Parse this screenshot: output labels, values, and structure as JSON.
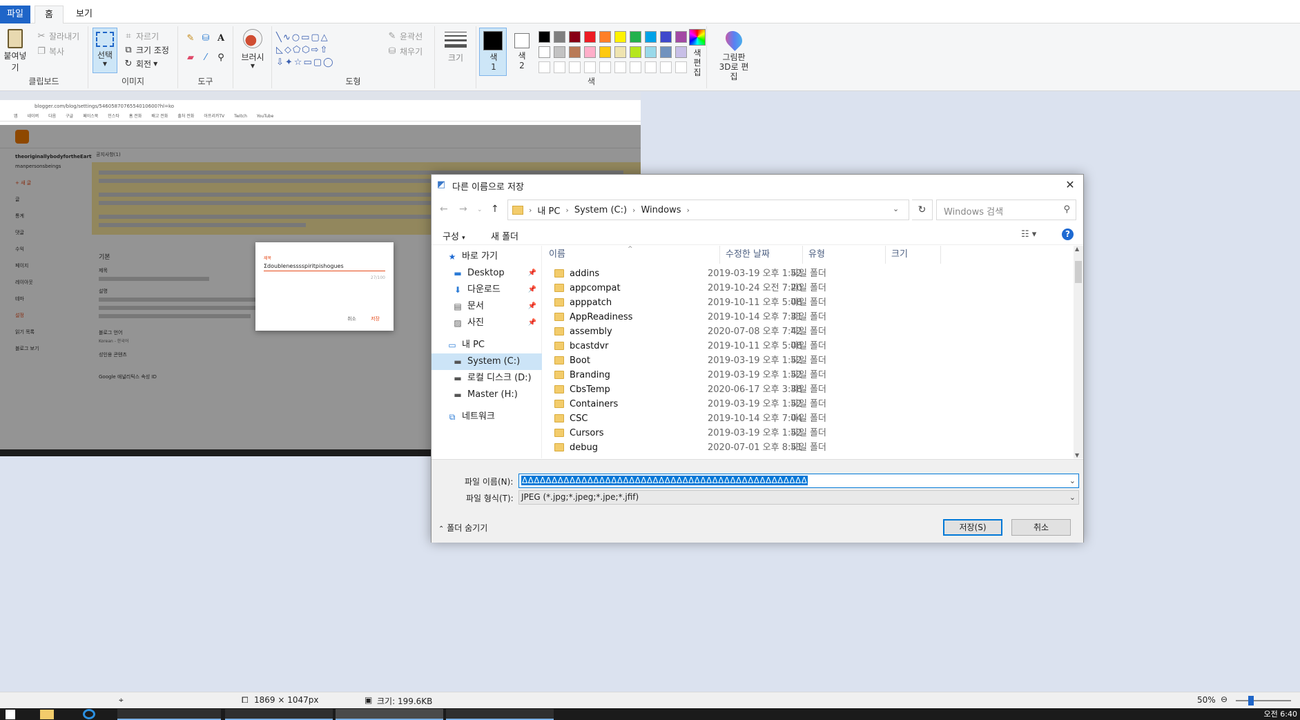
{
  "colors": {
    "accent": "#1e65c8",
    "selection": "#0078d7",
    "folder": "#f3cc6b"
  },
  "ribbon": {
    "tabs": {
      "file": "파일",
      "home": "홈",
      "view": "보기"
    },
    "clipboard": {
      "paste": "붙여넣기",
      "cut": "잘라내기",
      "copy": "복사",
      "label": "클립보드"
    },
    "image": {
      "select": "선택",
      "crop": "자르기",
      "resize": "크기 조정",
      "rotate": "회전",
      "label": "이미지"
    },
    "tools": {
      "label": "도구"
    },
    "brushes": {
      "label": "브러시"
    },
    "shapes": {
      "outline": "윤곽선",
      "fill": "채우기",
      "label": "도형"
    },
    "size": {
      "label": "크기"
    },
    "colors": {
      "color1": "색 1",
      "color2": "색 2",
      "edit": "색 편집",
      "label": "색",
      "palette_row1": [
        "#000000",
        "#7f7f7f",
        "#880015",
        "#ed1c24",
        "#ff7f27",
        "#fff200",
        "#22b14c",
        "#00a2e8",
        "#3f48cc",
        "#a349a4"
      ],
      "palette_row2": [
        "#ffffff",
        "#c3c3c3",
        "#b97a57",
        "#ffaec9",
        "#ffc90e",
        "#efe4b0",
        "#b5e61d",
        "#99d9ea",
        "#7092be",
        "#c8bfe7"
      ]
    },
    "paint3d": "그림판 3D로 편집"
  },
  "canvas": {
    "url": "blogger.com/blog/settings/5460587076554010600?hl=ko",
    "bookmarks": [
      "앱",
      "네이버",
      "다음",
      "구글",
      "페이스북",
      "인스타",
      "홈 전화",
      "배고 전화",
      "출처 전화",
      "아프리카TV",
      "Twitch",
      "YouTube"
    ],
    "blog_name": "theoriginallybodyfortheEarth",
    "blog_sub": "manpersonsbeings",
    "new_post": "+ 새 글",
    "side_items": [
      "글",
      "통계",
      "댓글",
      "수익",
      "페이지",
      "레이아웃",
      "테마",
      "설정",
      "읽기 목록"
    ],
    "side_view": "블로그 보기",
    "breadcrumb": "공지사항(1)",
    "section": "기본",
    "title_label": "제목",
    "desc_label": "설명",
    "lang_label": "블로그 언어",
    "lang_value": "Korean - 한국어",
    "adult_label": "성인용 콘텐츠",
    "ga_label": "Google 애널리틱스 속성 ID",
    "mini_dialog": {
      "label": "제목",
      "value": "Σdoublenesssspiritpishogues",
      "count": "27/100",
      "cancel": "취소",
      "save": "저장"
    }
  },
  "dialog": {
    "title": "다른 이름으로 저장",
    "path": [
      "내 PC",
      "System (C:)",
      "Windows"
    ],
    "search_placeholder": "Windows 검색",
    "organize": "구성",
    "new_folder": "새 폴더",
    "nav": {
      "quick": "바로 가기",
      "desktop": "Desktop",
      "downloads": "다운로드",
      "documents": "문서",
      "pictures": "사진",
      "thispc": "내 PC",
      "system": "System (C:)",
      "local_d": "로컬 디스크 (D:)",
      "master": "Master (H:)",
      "network": "네트워크"
    },
    "columns": {
      "name": "이름",
      "date": "수정한 날짜",
      "type": "유형",
      "size": "크기"
    },
    "files": [
      {
        "name": "addins",
        "date": "2019-03-19 오후 1:52",
        "type": "파일 폴더"
      },
      {
        "name": "appcompat",
        "date": "2019-10-24 오전 7:20",
        "type": "파일 폴더"
      },
      {
        "name": "apppatch",
        "date": "2019-10-11 오후 5:08",
        "type": "파일 폴더"
      },
      {
        "name": "AppReadiness",
        "date": "2019-10-14 오후 7:31",
        "type": "파일 폴더"
      },
      {
        "name": "assembly",
        "date": "2020-07-08 오후 7:42",
        "type": "파일 폴더"
      },
      {
        "name": "bcastdvr",
        "date": "2019-10-11 오후 5:08",
        "type": "파일 폴더"
      },
      {
        "name": "Boot",
        "date": "2019-03-19 오후 1:52",
        "type": "파일 폴더"
      },
      {
        "name": "Branding",
        "date": "2019-03-19 오후 1:52",
        "type": "파일 폴더"
      },
      {
        "name": "CbsTemp",
        "date": "2020-06-17 오후 3:38",
        "type": "파일 폴더"
      },
      {
        "name": "Containers",
        "date": "2019-03-19 오후 1:52",
        "type": "파일 폴더"
      },
      {
        "name": "CSC",
        "date": "2019-10-14 오후 7:04",
        "type": "파일 폴더"
      },
      {
        "name": "Cursors",
        "date": "2019-03-19 오후 1:52",
        "type": "파일 폴더"
      },
      {
        "name": "debug",
        "date": "2020-07-01 오후 8:51",
        "type": "파일 폴더"
      }
    ],
    "filename_label": "파일 이름(N):",
    "filename_value": "ΔΔΔΔΔΔΔΔΔΔΔΔΔΔΔΔΔΔΔΔΔΔΔΔΔΔΔΔΔΔΔΔΔΔΔΔΔΔΔΔΔΔΔΔΔΔΔΔ",
    "filetype_label": "파일 형식(T):",
    "filetype_value": "JPEG (*.jpg;*.jpeg;*.jpe;*.jfif)",
    "hide_folders": "폴더 숨기기",
    "save": "저장(S)",
    "cancel": "취소"
  },
  "status": {
    "dimensions": "1869 × 1047px",
    "size": "크기: 199.6KB",
    "zoom": "50%"
  },
  "taskbar": {
    "clock": "오전 6:40"
  }
}
